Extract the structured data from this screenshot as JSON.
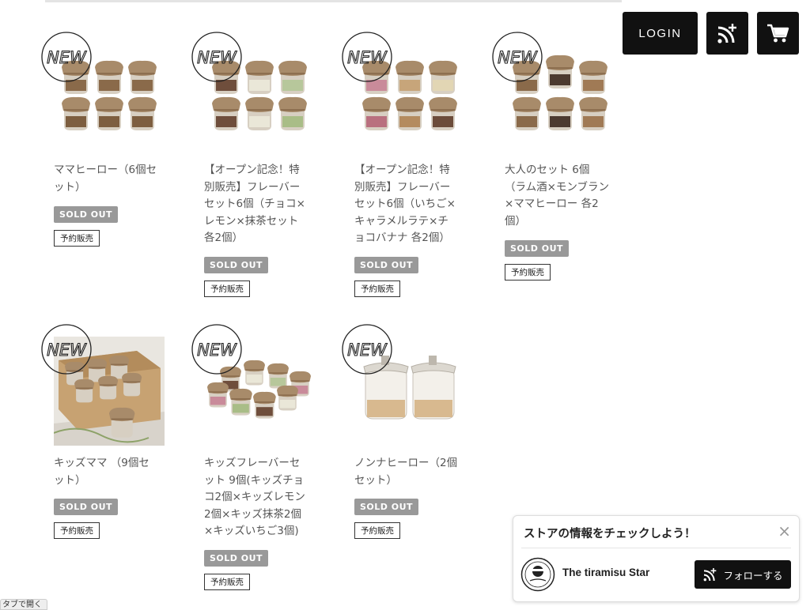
{
  "header": {
    "login_label": "LOGIN",
    "follow_icon": "rss-plus-icon",
    "cart_icon": "cart-icon"
  },
  "badge_text": "NEW",
  "products": [
    {
      "name": "ママヒーロー（6個セット）",
      "status": "SOLD OUT",
      "tag": "予約販売"
    },
    {
      "name": "【オープン記念！特別販売】フレーバーセット6個（チョコ×レモン×抹茶セット 各2個）",
      "status": "SOLD OUT",
      "tag": "予約販売"
    },
    {
      "name": "【オープン記念！特別販売】フレーバーセット6個（いちご×キャラメルラテ×チョコバナナ 各2個）",
      "status": "SOLD OUT",
      "tag": "予約販売"
    },
    {
      "name": "大人のセット 6個（ラム酒×モンブラン×ママヒーロー 各2個）",
      "status": "SOLD OUT",
      "tag": "予約販売"
    },
    {
      "name": "キッズママ （9個セット）",
      "status": "SOLD OUT",
      "tag": "予約販売"
    },
    {
      "name": "キッズフレーバーセット 9個(キッズチョコ2個×キッズレモン2個×キッズ抹茶2個×キッズいちご3個)",
      "status": "SOLD OUT",
      "tag": "予約販売"
    },
    {
      "name": "ノンナヒーロー（2個セット）",
      "status": "SOLD OUT",
      "tag": "予約販売"
    }
  ],
  "popup": {
    "title": "ストアの情報をチェックしよう！",
    "close": "×",
    "store_name": "The tiramisu Star",
    "follow_label": "フォローする"
  },
  "bottom_tab": "タブで開く",
  "colors": {
    "button_bg": "#111111",
    "sold_out_bg": "#999999"
  }
}
